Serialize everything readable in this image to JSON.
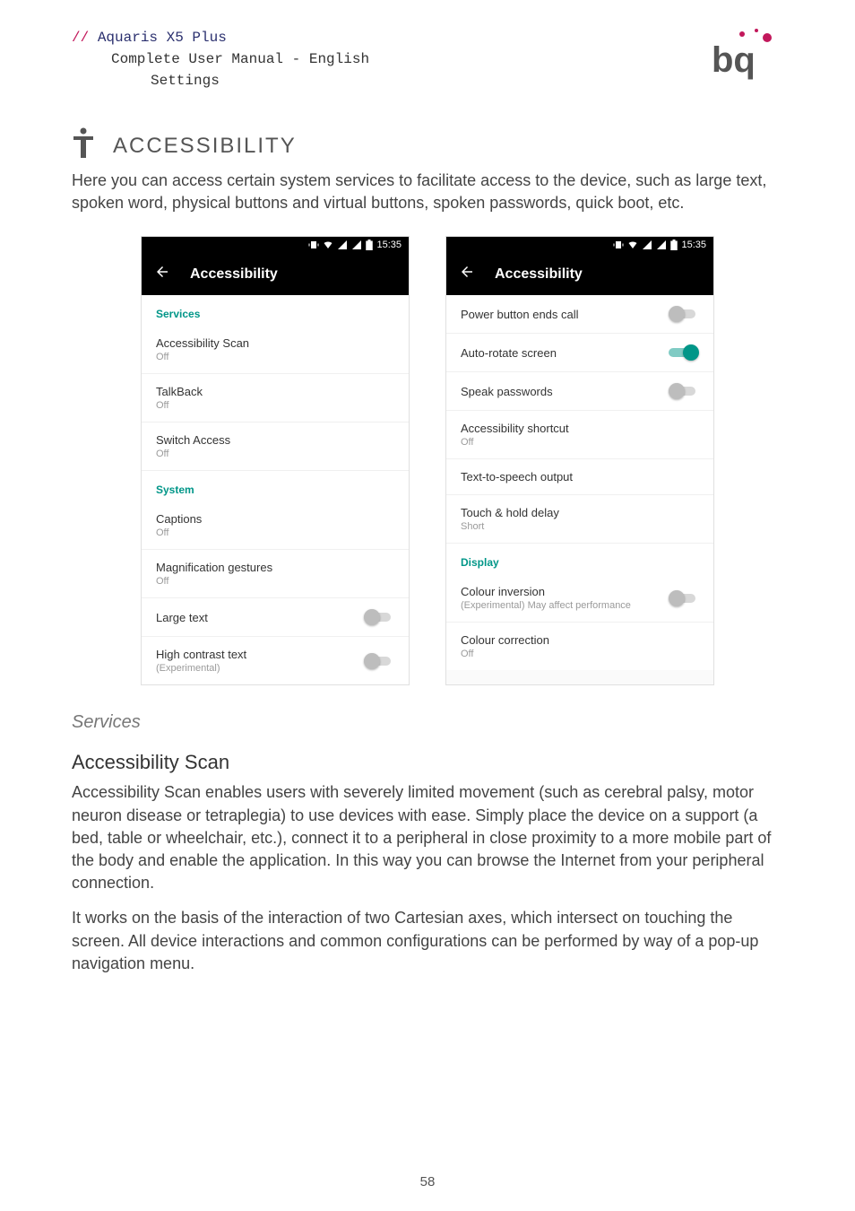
{
  "header": {
    "slashes": "//",
    "product": "Aquaris X5 Plus",
    "subtitle": "Complete User Manual - English",
    "crumb": "Settings"
  },
  "section": {
    "title": "ACCESSIBILITY",
    "intro": "Here you can access certain system services to facilitate access to the device, such as large text, spoken word, physical buttons and virtual buttons, spoken passwords, quick boot, etc."
  },
  "status_time": "15:35",
  "appbar_title": "Accessibility",
  "left_screen": {
    "sub1": "Services",
    "r1": {
      "p": "Accessibility Scan",
      "s": "Off"
    },
    "r2": {
      "p": "TalkBack",
      "s": "Off"
    },
    "r3": {
      "p": "Switch Access",
      "s": "Off"
    },
    "sub2": "System",
    "r4": {
      "p": "Captions",
      "s": "Off"
    },
    "r5": {
      "p": "Magnification gestures",
      "s": "Off"
    },
    "r6": {
      "p": "Large text"
    },
    "r7": {
      "p": "High contrast text",
      "s": "(Experimental)"
    }
  },
  "right_screen": {
    "r1": {
      "p": "Power button ends call"
    },
    "r2": {
      "p": "Auto-rotate screen"
    },
    "r3": {
      "p": "Speak passwords"
    },
    "r4": {
      "p": "Accessibility shortcut",
      "s": "Off"
    },
    "r5": {
      "p": "Text-to-speech output"
    },
    "r6": {
      "p": "Touch & hold delay",
      "s": "Short"
    },
    "sub1": "Display",
    "r7": {
      "p": "Colour inversion",
      "s": "(Experimental) May affect performance"
    },
    "r8": {
      "p": "Colour correction",
      "s": "Off"
    }
  },
  "text": {
    "services_h": "Services",
    "scan_h": "Accessibility Scan",
    "scan_p1": "Accessibility Scan enables users with severely limited movement (such as cerebral palsy, motor neuron disease or tetraplegia) to use devices with ease. Simply place the device on a support (a bed, table or wheelchair, etc.), connect it to a peripheral in close proximity to a more mobile part of the body and enable the application. In this way you can browse the Internet from your peripheral connection.",
    "scan_p2": "It works on the basis of the interaction of two Cartesian axes, which intersect on touching the screen. All device interactions and common configurations can be performed by way of a pop-up navigation menu."
  },
  "page_number": "58"
}
